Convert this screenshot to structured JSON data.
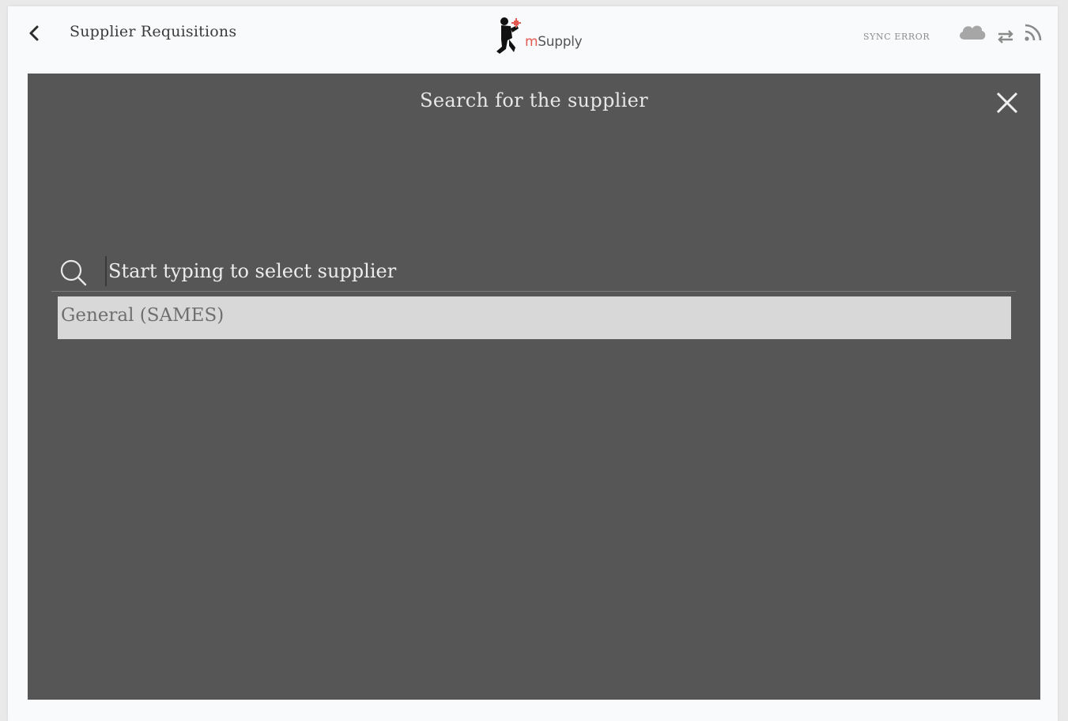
{
  "header": {
    "back_icon": "chevron-left-icon",
    "title": "Supplier Requisitions",
    "logo": {
      "prefix": "m",
      "name": "Supply"
    },
    "sync_status": "SYNC ERROR",
    "icons": [
      "cloud-icon",
      "sync-arrows-icon",
      "rss-icon"
    ]
  },
  "modal": {
    "title": "Search for the supplier",
    "close_icon": "close-icon",
    "search": {
      "icon": "search-icon",
      "value": "",
      "placeholder": "Start typing to select supplier"
    },
    "results": [
      {
        "label": "General (SAMES)"
      }
    ]
  },
  "colors": {
    "modal_background": "#565656",
    "result_highlight": "#d8d8d8",
    "logo_accent": "#e35a52",
    "header_background": "#f9fafb"
  }
}
